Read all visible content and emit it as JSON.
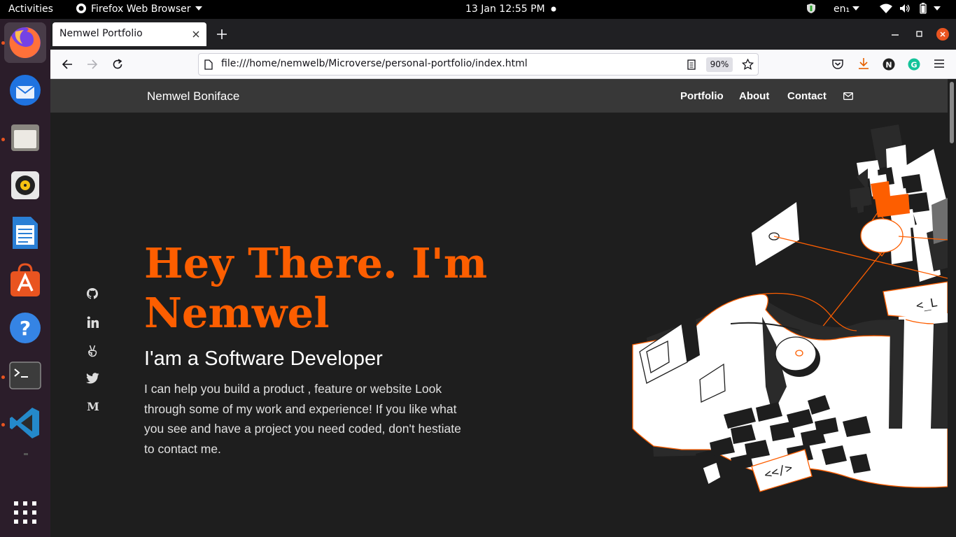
{
  "os": {
    "activities": "Activities",
    "app_menu": "Firefox Web Browser",
    "clock": "13 Jan  12:55 PM",
    "keyboard_layout": "en₁"
  },
  "dock": {
    "apps": [
      {
        "name": "Firefox",
        "icon": "firefox-icon",
        "active": true
      },
      {
        "name": "Thunderbird",
        "icon": "thunderbird-icon"
      },
      {
        "name": "Files",
        "icon": "files-icon"
      },
      {
        "name": "Rhythmbox",
        "icon": "rhythmbox-icon"
      },
      {
        "name": "LibreOffice Writer",
        "icon": "writer-icon"
      },
      {
        "name": "Ubuntu Software",
        "icon": "software-icon"
      },
      {
        "name": "Help",
        "icon": "help-icon"
      },
      {
        "name": "Terminal",
        "icon": "terminal-icon"
      },
      {
        "name": "VS Code",
        "icon": "vscode-icon"
      }
    ]
  },
  "browser": {
    "tab_title": "Nemwel Portfolio",
    "url": "file:///home/nemwelb/Microverse/personal-portfolio/index.html",
    "zoom": "90%"
  },
  "site": {
    "brand": "Nemwel Boniface",
    "nav": [
      "Portfolio",
      "About",
      "Contact"
    ],
    "hero": {
      "heading_line1": "Hey There. I'm",
      "heading_line2": "Nemwel",
      "subtitle": "I'am a Software Developer",
      "para_line1": "I can help you build a product , feature or website Look",
      "para_line2": "through some of my work and experience! If you like what",
      "para_line3": "you see and have a project you need coded, don't hestiate",
      "para_line4": "to contact me."
    },
    "social": [
      "github-icon",
      "linkedin-icon",
      "angellist-icon",
      "twitter-icon",
      "medium-icon"
    ],
    "illustration_code_labels": [
      "<_L",
      "<</>"
    ]
  },
  "colors": {
    "accent": "#fd5e00",
    "page_bg": "#1e1e1e",
    "nav_bg": "#383838"
  }
}
